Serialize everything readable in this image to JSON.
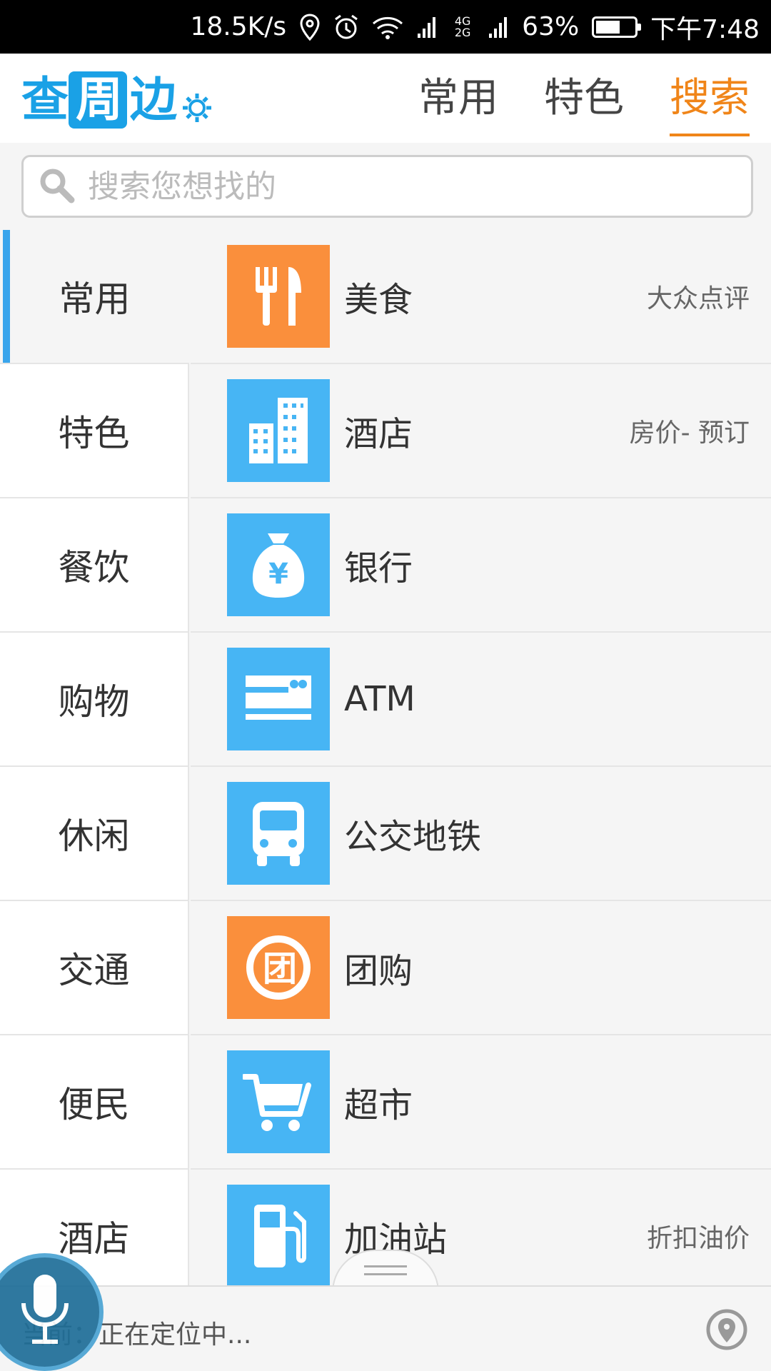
{
  "status_bar": {
    "speed": "18.5K/s",
    "network_badge": "4G 2G",
    "battery_percent": "63%",
    "battery_level": 0.63,
    "time": "下午7:48"
  },
  "header": {
    "logo": [
      "查",
      "周",
      "边"
    ],
    "tabs": [
      {
        "label": "常用",
        "active": false
      },
      {
        "label": "特色",
        "active": false
      },
      {
        "label": "搜索",
        "active": true
      }
    ],
    "accent_color": "#f08519"
  },
  "search": {
    "placeholder": "搜索您想找的",
    "value": ""
  },
  "categories": [
    {
      "label": "常用",
      "active": true
    },
    {
      "label": "特色"
    },
    {
      "label": "餐饮"
    },
    {
      "label": "购物"
    },
    {
      "label": "休闲"
    },
    {
      "label": "交通"
    },
    {
      "label": "便民"
    },
    {
      "label": "酒店"
    }
  ],
  "items": [
    {
      "name": "美食",
      "note": "大众点评",
      "icon": "fork-knife-icon",
      "color": "#fa8f3c"
    },
    {
      "name": "酒店",
      "note": "房价- 预订",
      "icon": "building-icon",
      "color": "#47b5f4"
    },
    {
      "name": "银行",
      "note": "",
      "icon": "money-bag-icon",
      "color": "#47b5f4"
    },
    {
      "name": "ATM",
      "note": "",
      "icon": "card-icon",
      "color": "#47b5f4"
    },
    {
      "name": "公交地铁",
      "note": "",
      "icon": "bus-icon",
      "color": "#47b5f4"
    },
    {
      "name": "团购",
      "note": "",
      "icon": "group-buy-icon",
      "color": "#fa8f3c"
    },
    {
      "name": "超市",
      "note": "",
      "icon": "cart-icon",
      "color": "#47b5f4"
    },
    {
      "name": "加油站",
      "note": "折扣油价",
      "icon": "fuel-icon",
      "color": "#47b5f4"
    }
  ],
  "bottom": {
    "location_text": "当前：正在定位中..."
  }
}
